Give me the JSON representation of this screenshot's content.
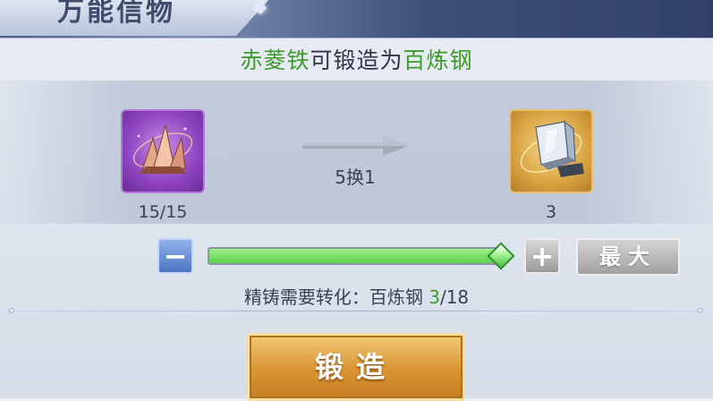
{
  "header": {
    "title": "万能信物"
  },
  "subtitle": {
    "source_name": "赤菱铁",
    "middle": "可锻造为",
    "target_name": "百炼钢"
  },
  "conversion": {
    "source_item": {
      "name": "赤菱铁",
      "count": "15/15",
      "icon": "copper-crystal-ore-icon"
    },
    "target_item": {
      "name": "百炼钢",
      "count": "3",
      "icon": "steel-ingot-icon"
    },
    "ratio": "5换1"
  },
  "slider": {
    "level_fraction": 1.0,
    "minus_label": "−",
    "plus_label": "+",
    "max_label": "最大"
  },
  "requirement": {
    "prefix": "精铸需要转化：百炼钢 ",
    "current": "3",
    "total": "/18"
  },
  "action": {
    "forge_label": "锻造"
  },
  "colors": {
    "accent_green": "#3d9a2b",
    "forge_gold": "#d99432",
    "slider_green": "#5fd04e"
  }
}
